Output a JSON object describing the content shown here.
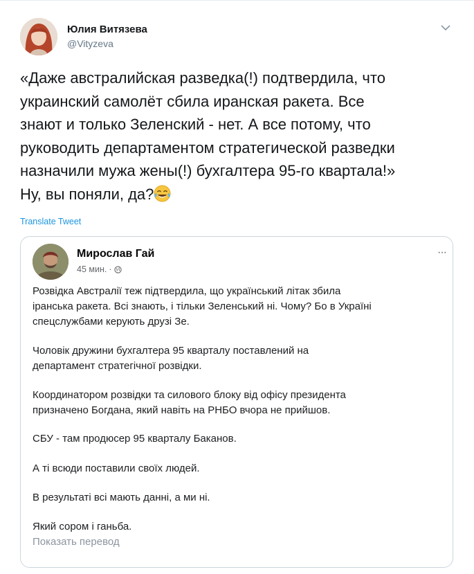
{
  "tweet": {
    "author_name": "Юлия Витязева",
    "author_handle": "@Vityzeva",
    "text": "«Даже австралийская разведка(!) подтвердила, что\nукраинский самолёт сбила иранская ракета. Все\nзнают и только Зеленский - нет. А все потому, что\nруководить департаментом стратегической разведки\nназначили мужа жены(!) бухгалтера 95-го квартала!»\nНу, вы поняли, да?",
    "emoji_icon": "face-with-tears-of-joy-icon",
    "translate_label": "Translate Tweet"
  },
  "quoted_post": {
    "author_name": "Мирослав Гай",
    "time": "45 мин.",
    "separator": "·",
    "audience_icon": "globe-icon",
    "more_label": "···",
    "paragraphs": [
      "Розвідка Австралії теж підтвердила, що український літак збила\nіранська ракета. Всі знають, і тільки Зеленський ні. Чому? Бо в Україні\nспецслужбами керують друзі Зе.",
      "Чоловік дружини бухгалтера 95 кварталу поставлений на\nдепартамент стратегічної розвідки.",
      "Координатором розвідки та силового блоку від офісу президента\nпризначено Богдана, який навіть на РНБО вчора не прийшов.",
      "СБУ - там продюсер 95 кварталу Баканов.",
      "А ті всюди поставили своїх людей.",
      "В результаті всі мають данні, а ми ні.",
      "Який сором і ганьба."
    ],
    "translate_label": "Показать перевод"
  },
  "colors": {
    "link": "#1b95e0",
    "border": "#ccd6dd",
    "muted": "#657786"
  }
}
